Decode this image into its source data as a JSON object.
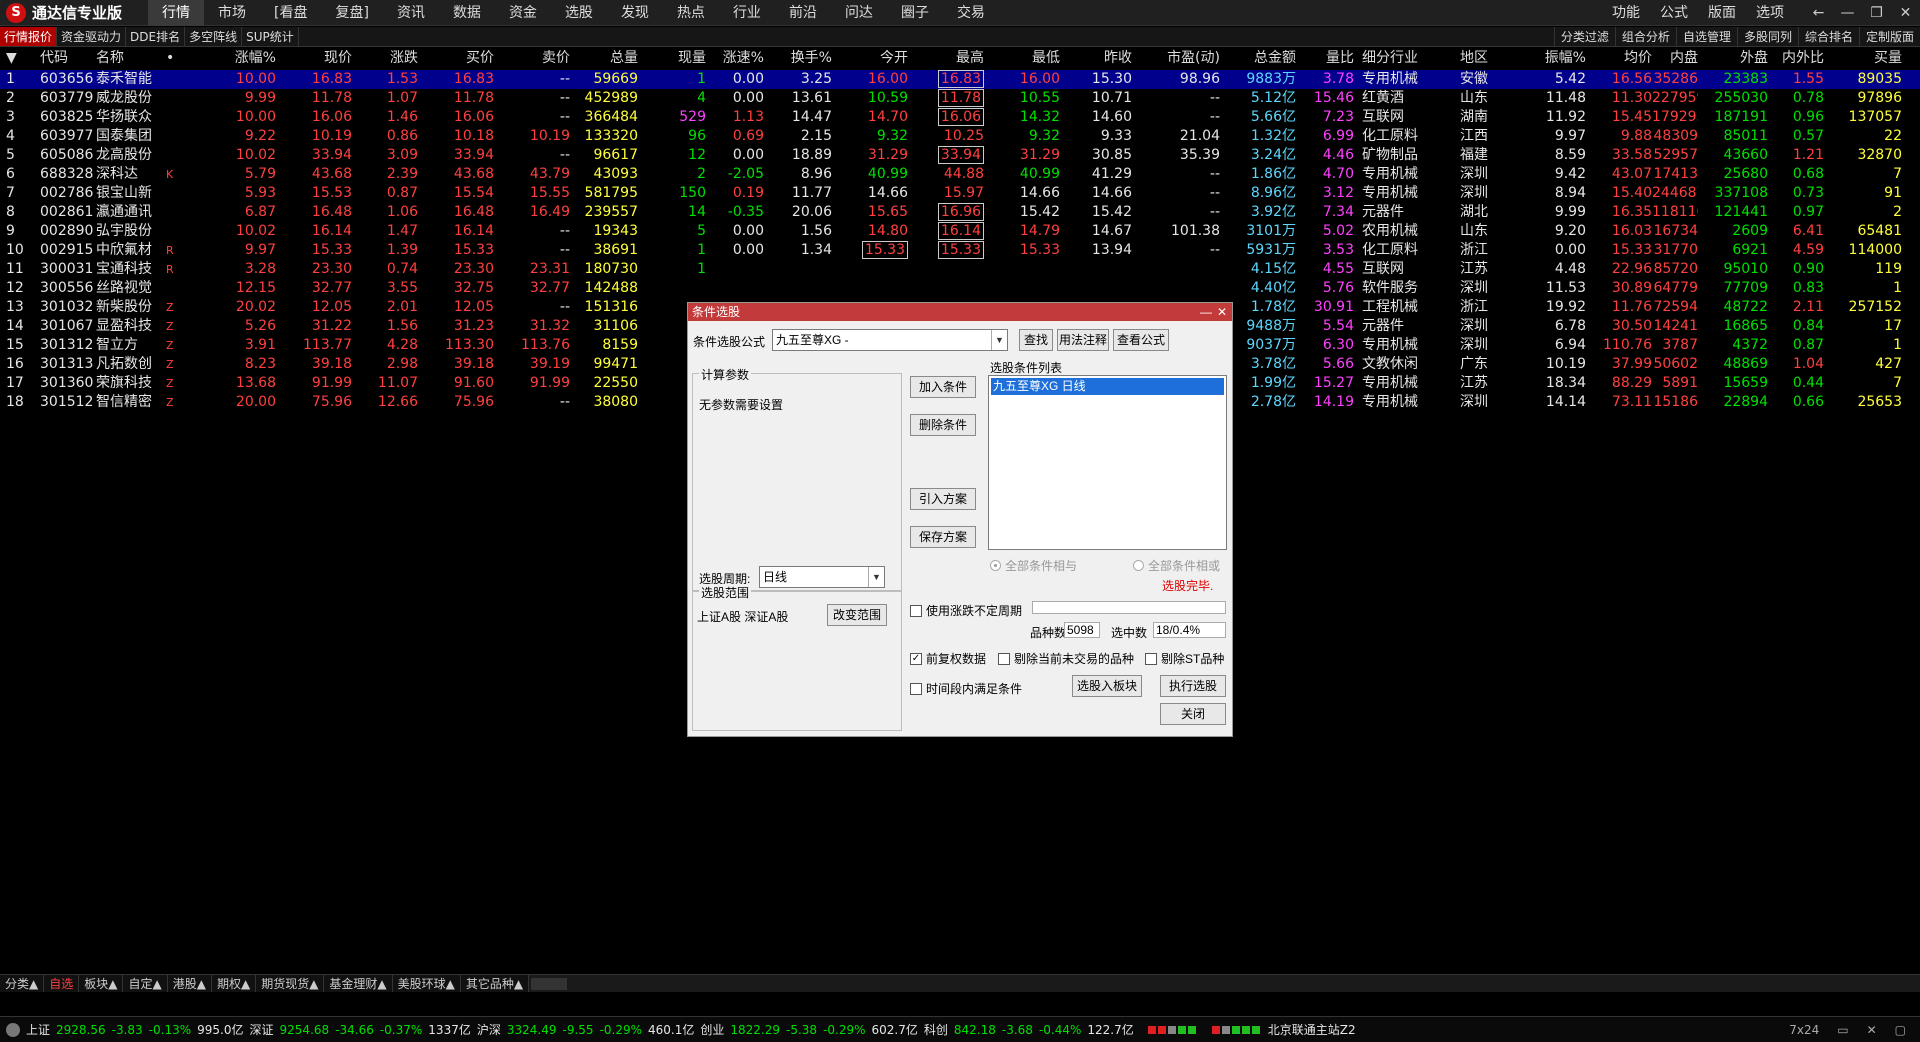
{
  "app": {
    "logo_glyph": "S",
    "title": "通达信专业版"
  },
  "menu": [
    "行情",
    "市场",
    "[看盘",
    "复盘]",
    "资讯",
    "数据",
    "资金",
    "选股",
    "发现",
    "热点",
    "行业",
    "前沿",
    "问达",
    "圈子",
    "交易"
  ],
  "menu_active": 0,
  "top_right": [
    "功能",
    "公式",
    "版面",
    "选项"
  ],
  "window_buttons": {
    "back": "←",
    "minimize": "—",
    "restore": "❐",
    "close": "✕"
  },
  "subnav": [
    "行情报价",
    "资金驱动力",
    "DDE排名",
    "多空阵线",
    "SUP统计"
  ],
  "subnav_right": [
    "分类过滤",
    "组合分析",
    "自选管理",
    "多股同列",
    "综合排名",
    "定制版面"
  ],
  "table": {
    "headers": [
      "▼",
      "代码",
      "名称",
      "•",
      "涨幅%",
      "现价",
      "涨跌",
      "买价",
      "卖价",
      "总量",
      "现量",
      "涨速%",
      "换手%",
      "今开",
      "最高",
      "最低",
      "昨收",
      "市盈(动)",
      "总金额",
      "量比",
      "细分行业",
      "地区",
      "振幅%",
      "均价",
      "内盘",
      "外盘",
      "内外比",
      "买量"
    ],
    "rows": [
      [
        "1",
        "603656",
        "泰禾智能",
        "",
        "10.00",
        "16.83",
        "1.53",
        "16.83",
        "--",
        "59669",
        "1",
        "0.00",
        "3.25",
        "16.00",
        "16.83",
        "16.00",
        "15.30",
        "98.96",
        "9883万",
        "3.78",
        "专用机械",
        "安徽",
        "5.42",
        "16.56",
        "35286",
        "23383",
        "1.55",
        "89035"
      ],
      [
        "2",
        "603779",
        "威龙股份",
        "",
        "9.99",
        "11.78",
        "1.07",
        "11.78",
        "--",
        "452989",
        "4",
        "0.00",
        "13.61",
        "10.59",
        "11.78",
        "10.55",
        "10.71",
        "--",
        "5.12亿",
        "15.46",
        "红黄酒",
        "山东",
        "11.48",
        "11.30",
        "227959",
        "255030",
        "0.78",
        "97896"
      ],
      [
        "3",
        "603825",
        "华扬联众",
        "",
        "10.00",
        "16.06",
        "1.46",
        "16.06",
        "--",
        "366484",
        "529",
        "1.13",
        "14.47",
        "14.70",
        "16.06",
        "14.32",
        "14.60",
        "--",
        "5.66亿",
        "7.23",
        "互联网",
        "湖南",
        "11.92",
        "15.45",
        "179293",
        "187191",
        "0.96",
        "137057"
      ],
      [
        "4",
        "603977",
        "国泰集团",
        "",
        "9.22",
        "10.19",
        "0.86",
        "10.18",
        "10.19",
        "133320",
        "96",
        "0.69",
        "2.15",
        "9.32",
        "10.25",
        "9.32",
        "9.33",
        "21.04",
        "1.32亿",
        "6.99",
        "化工原料",
        "江西",
        "9.97",
        "9.88",
        "48309",
        "85011",
        "0.57",
        "22"
      ],
      [
        "5",
        "605086",
        "龙高股份",
        "",
        "10.02",
        "33.94",
        "3.09",
        "33.94",
        "--",
        "96617",
        "12",
        "0.00",
        "18.89",
        "31.29",
        "33.94",
        "31.29",
        "30.85",
        "35.39",
        "3.24亿",
        "4.46",
        "矿物制品",
        "福建",
        "8.59",
        "33.58",
        "52957",
        "43660",
        "1.21",
        "32870"
      ],
      [
        "6",
        "688328",
        "深科达",
        "K",
        "5.79",
        "43.68",
        "2.39",
        "43.68",
        "43.79",
        "43093",
        "2",
        "-2.05",
        "8.96",
        "40.99",
        "44.88",
        "40.99",
        "41.29",
        "--",
        "1.86亿",
        "4.70",
        "专用机械",
        "深圳",
        "9.42",
        "43.07",
        "17413",
        "25680",
        "0.68",
        "7"
      ],
      [
        "7",
        "002786",
        "银宝山新",
        "",
        "5.93",
        "15.53",
        "0.87",
        "15.54",
        "15.55",
        "581795",
        "150",
        "0.19",
        "11.77",
        "14.66",
        "15.97",
        "14.66",
        "14.66",
        "--",
        "8.96亿",
        "3.12",
        "专用机械",
        "深圳",
        "8.94",
        "15.40",
        "244687",
        "337108",
        "0.73",
        "91"
      ],
      [
        "8",
        "002861",
        "瀛通通讯",
        "",
        "6.87",
        "16.48",
        "1.06",
        "16.48",
        "16.49",
        "239557",
        "14",
        "-0.35",
        "20.06",
        "15.65",
        "16.96",
        "15.42",
        "15.42",
        "--",
        "3.92亿",
        "7.34",
        "元器件",
        "湖北",
        "9.99",
        "16.35",
        "118116",
        "121441",
        "0.97",
        "2"
      ],
      [
        "9",
        "002890",
        "弘宇股份",
        "",
        "10.02",
        "16.14",
        "1.47",
        "16.14",
        "--",
        "19343",
        "5",
        "0.00",
        "1.56",
        "14.80",
        "16.14",
        "14.79",
        "14.67",
        "101.38",
        "3101万",
        "5.02",
        "农用机械",
        "山东",
        "9.20",
        "16.03",
        "16734",
        "2609",
        "6.41",
        "65481"
      ],
      [
        "10",
        "002915",
        "中欣氟材",
        "R",
        "9.97",
        "15.33",
        "1.39",
        "15.33",
        "--",
        "38691",
        "1",
        "0.00",
        "1.34",
        "15.33",
        "15.33",
        "15.33",
        "13.94",
        "--",
        "5931万",
        "3.53",
        "化工原料",
        "浙江",
        "0.00",
        "15.33",
        "31770",
        "6921",
        "4.59",
        "114000"
      ],
      [
        "11",
        "300031",
        "宝通科技",
        "R",
        "3.28",
        "23.30",
        "0.74",
        "23.30",
        "23.31",
        "180730",
        "1",
        "",
        "",
        "",
        "",
        "",
        "",
        "",
        "4.15亿",
        "4.55",
        "互联网",
        "江苏",
        "4.48",
        "22.96",
        "85720",
        "95010",
        "0.90",
        "119"
      ],
      [
        "12",
        "300556",
        "丝路视觉",
        "",
        "12.15",
        "32.77",
        "3.55",
        "32.75",
        "32.77",
        "142488",
        "",
        "",
        "",
        "",
        "",
        "",
        "",
        "",
        "4.40亿",
        "5.76",
        "软件服务",
        "深圳",
        "11.53",
        "30.89",
        "64779",
        "77709",
        "0.83",
        "1"
      ],
      [
        "13",
        "301032",
        "新柴股份",
        "Z",
        "20.02",
        "12.05",
        "2.01",
        "12.05",
        "--",
        "151316",
        "",
        "",
        "",
        "",
        "",
        "",
        "",
        "",
        "1.78亿",
        "30.91",
        "工程机械",
        "浙江",
        "19.92",
        "11.76",
        "72594",
        "48722",
        "2.11",
        "257152"
      ],
      [
        "14",
        "301067",
        "显盈科技",
        "Z",
        "5.26",
        "31.22",
        "1.56",
        "31.23",
        "31.32",
        "31106",
        "",
        "",
        "",
        "",
        "",
        "",
        "",
        "",
        "9488万",
        "5.54",
        "元器件",
        "深圳",
        "6.78",
        "30.50",
        "14241",
        "16865",
        "0.84",
        "17"
      ],
      [
        "15",
        "301312",
        "智立方",
        "Z",
        "3.91",
        "113.77",
        "4.28",
        "113.30",
        "113.76",
        "8159",
        "",
        "",
        "",
        "",
        "",
        "",
        "",
        "",
        "9037万",
        "6.30",
        "专用机械",
        "深圳",
        "6.94",
        "110.76",
        "3787",
        "4372",
        "0.87",
        "1"
      ],
      [
        "16",
        "301313",
        "凡拓数创",
        "Z",
        "8.23",
        "39.18",
        "2.98",
        "39.18",
        "39.19",
        "99471",
        "1",
        "",
        "",
        "",
        "",
        "",
        "",
        "",
        "3.78亿",
        "5.66",
        "文教休闲",
        "广东",
        "10.19",
        "37.99",
        "50602",
        "48869",
        "1.04",
        "427"
      ],
      [
        "17",
        "301360",
        "荣旗科技",
        "Z",
        "13.68",
        "91.99",
        "11.07",
        "91.60",
        "91.99",
        "22550",
        "",
        "",
        "",
        "",
        "",
        "",
        "",
        "",
        "1.99亿",
        "15.27",
        "专用机械",
        "江苏",
        "18.34",
        "88.29",
        "5891",
        "15659",
        "0.44",
        "7"
      ],
      [
        "18",
        "301512",
        "智信精密",
        "Z",
        "20.00",
        "75.96",
        "12.66",
        "75.96",
        "--",
        "38080",
        "",
        "",
        "",
        "",
        "",
        "",
        "",
        "",
        "2.78亿",
        "14.19",
        "专用机械",
        "深圳",
        "14.14",
        "73.11",
        "15186",
        "22894",
        "0.66",
        "25653"
      ]
    ],
    "boxed_cells": [
      [
        0,
        14
      ],
      [
        1,
        14
      ],
      [
        2,
        14
      ],
      [
        4,
        14
      ],
      [
        7,
        14
      ],
      [
        8,
        14
      ],
      [
        9,
        13
      ],
      [
        9,
        14
      ]
    ]
  },
  "dialog": {
    "title": "条件选股",
    "formula_label": "条件选股公式",
    "formula_value": "九五至尊XG   -",
    "btn_find": "查找",
    "btn_usage": "用法注释",
    "btn_view": "查看公式",
    "params_group": "计算参数",
    "params_text": "无参数需要设置",
    "period_label": "选股周期:",
    "period_value": "日线",
    "btn_add": "加入条件",
    "btn_delete": "删除条件",
    "btn_import": "引入方案",
    "btn_save": "保存方案",
    "list_label": "选股条件列表",
    "list_items": [
      "九五至尊XG  日线"
    ],
    "radio_and": "全部条件相与",
    "radio_or": "全部条件相或",
    "status_done": "选股完毕.",
    "scope_group": "选股范围",
    "scope_text": "上证A股 深证A股",
    "btn_scope": "改变范围",
    "chk_uncertain": "使用涨跌不定周期",
    "count_label": "品种数",
    "count_value": "5098",
    "selected_label": "选中数",
    "selected_value": "18/0.4%",
    "chk_prev_adj": "前复权数据",
    "chk_remove_untraded": "剔除当前未交易的品种",
    "chk_remove_st": "剔除ST品种",
    "chk_timerange": "时间段内满足条件",
    "btn_to_block": "选股入板块",
    "btn_execute": "执行选股",
    "btn_close": "关闭",
    "minimize": "—",
    "close": "✕",
    "check_mark": "✓"
  },
  "bottom_tabs": [
    "分类▲",
    "自选",
    "板块▲",
    "自定▲",
    "港股▲",
    "期权▲",
    "期货现货▲",
    "基金理财▲",
    "美股环球▲",
    "其它品种▲"
  ],
  "status": {
    "sh_label": "上证",
    "sh_value": "2928.56",
    "sh_change": "-3.83",
    "sh_pct": "-0.13%",
    "sh_amount": "995.0亿",
    "sz_label": "深证",
    "sz_value": "9254.68",
    "sz_change": "-34.66",
    "sz_pct": "-0.37%",
    "sz_amount": "1337亿",
    "hs_label": "沪深",
    "hs_value": "3324.49",
    "hs_change": "-9.55",
    "hs_pct": "-0.29%",
    "hs_amount": "460.1亿",
    "cy_label": "创业",
    "cy_value": "1822.29",
    "cy_change": "-5.38",
    "cy_pct": "-0.29%",
    "cy_amount": "602.7亿",
    "kc_label": "科创",
    "kc_value": "842.18",
    "kc_change": "-3.68",
    "kc_pct": "-0.44%",
    "kc_amount": "122.7亿",
    "server": "北京联通主站Z2",
    "service": "7x24"
  },
  "colors": {
    "up": "#ff4040",
    "down": "#00e000",
    "neutral": "#e6e6e6",
    "volume": "#ffff3c",
    "amount": "#5cd8ff",
    "ratio": "#ff40ff",
    "selected_row": "#00008c",
    "dialog_title": "#c33a3a"
  }
}
